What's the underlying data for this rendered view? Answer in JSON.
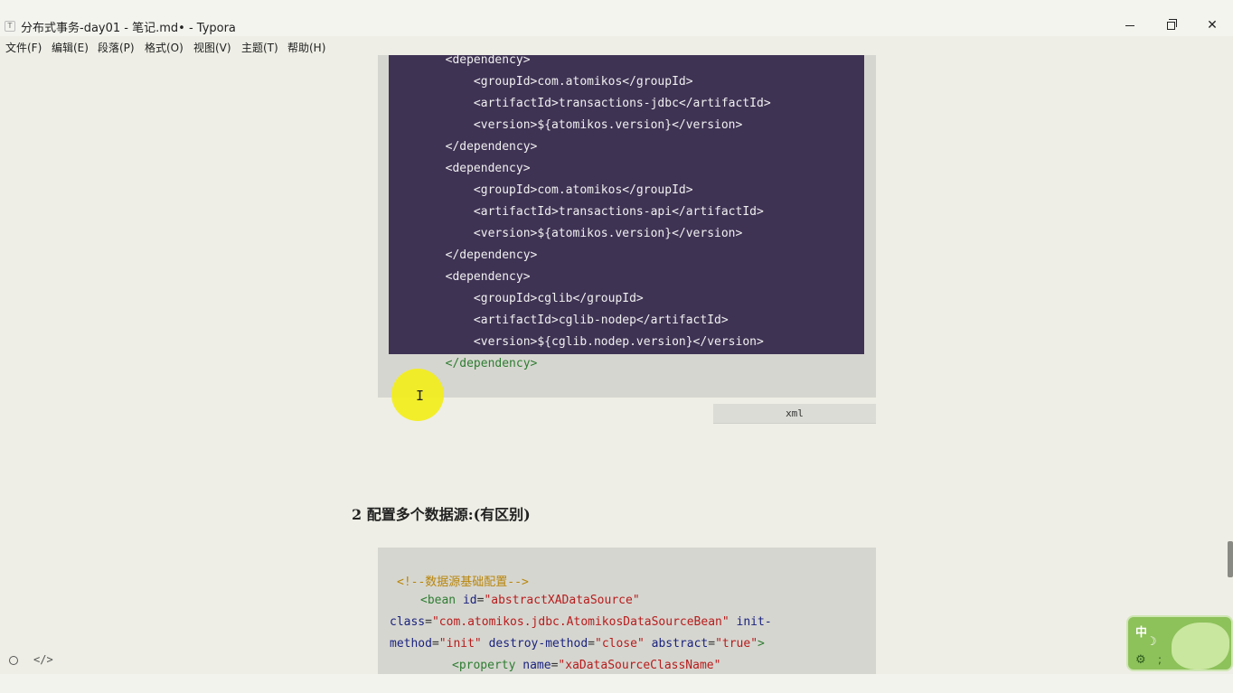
{
  "window": {
    "title": "分布式事务-day01 - 笔记.md• - Typora",
    "app_icon": "T",
    "minimize_icon": "minimize-icon",
    "maximize_icon": "restore-icon",
    "close_icon": "close-icon",
    "close_glyph": "✕"
  },
  "menubar": {
    "items": [
      "文件(F)",
      "编辑(E)",
      "段落(P)",
      "格式(O)",
      "视图(V)",
      "主题(T)",
      "帮助(H)"
    ]
  },
  "code_block_1": {
    "language": "xml",
    "lines": [
      "        <dependency>",
      "            <groupId>com.atomikos</groupId>",
      "            <artifactId>transactions-jdbc</artifactId>",
      "            <version>${atomikos.version}</version>",
      "        </dependency>",
      "        <dependency>",
      "            <groupId>com.atomikos</groupId>",
      "            <artifactId>transactions-api</artifactId>",
      "            <version>${atomikos.version}</version>",
      "        </dependency>",
      "        <dependency>",
      "            <groupId>cglib</groupId>",
      "            <artifactId>cglib-nodep</artifactId>",
      "            <version>${cglib.nodep.version}</version>",
      "        </dependency>"
    ],
    "selection_color": "#3f3354"
  },
  "cursor": {
    "ibeam": "I",
    "highlight_color": "#f3ee1a"
  },
  "heading": "2 配置多个数据源:(有区别)",
  "code_block_2": {
    "comment": "<!--数据源基础配置-->",
    "bean_open": "<bean",
    "attr_id": "id",
    "val_id": "\"abstractXADataSource\"",
    "attr_class": "class",
    "val_class": "\"com.atomikos.jdbc.AtomikosDataSourceBean\"",
    "attr_init_1": "init-",
    "attr_init_2": "method",
    "val_init": "\"init\"",
    "attr_destroy": "destroy-method",
    "val_destroy": "\"close\"",
    "attr_abstract": "abstract",
    "val_abstract": "\"true\"",
    "gt": ">",
    "property_open": "<property",
    "attr_name": "name",
    "val_name": "\"xaDataSourceClassName\""
  },
  "status": {
    "circle_icon": "outline-toggle-icon",
    "code_icon_text": "</>"
  },
  "ime": {
    "mode": "中",
    "moon": "☽",
    "gear": "⚙",
    "punct": ";"
  }
}
